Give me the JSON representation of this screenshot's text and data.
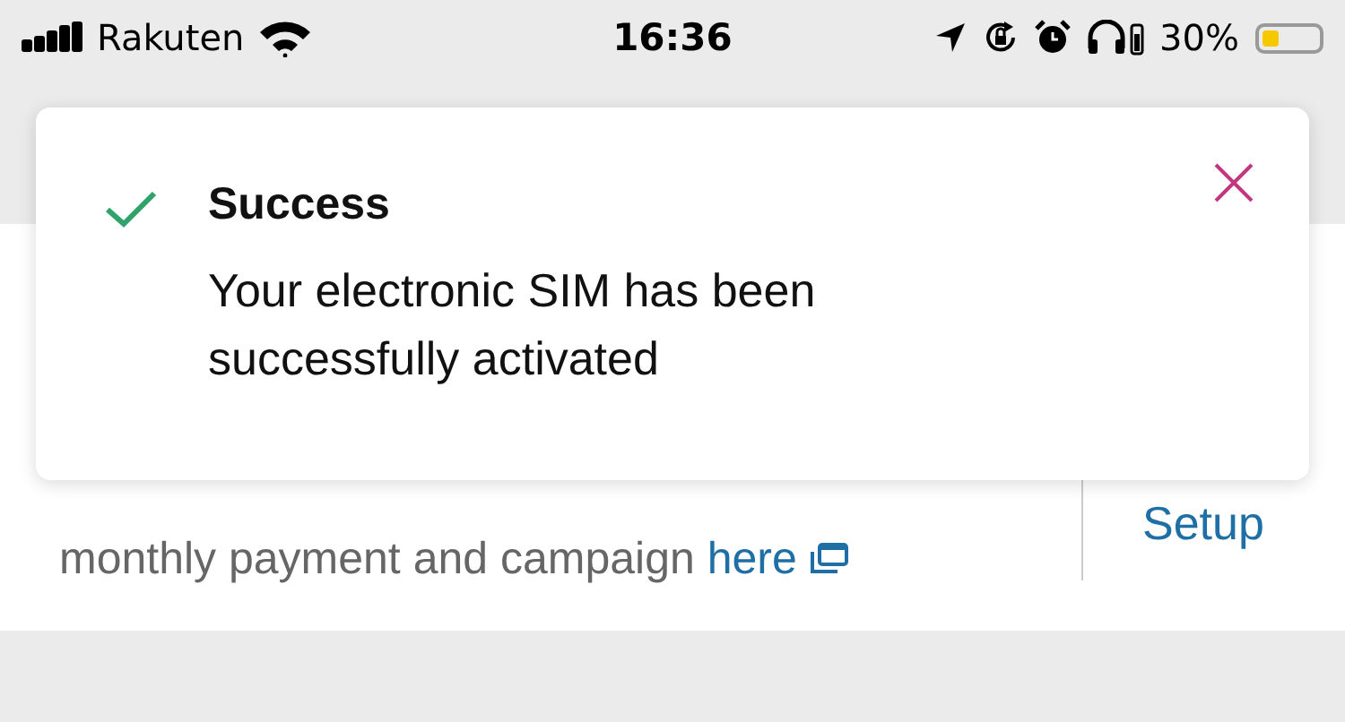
{
  "status_bar": {
    "carrier": "Rakuten",
    "time": "16:36",
    "battery_text": "30%"
  },
  "points_card": {
    "text": "monthly payment and campaign",
    "link": "here",
    "action": "Setup"
  },
  "toast": {
    "title": "Success",
    "message": "Your electronic SIM has been successfully activated"
  }
}
